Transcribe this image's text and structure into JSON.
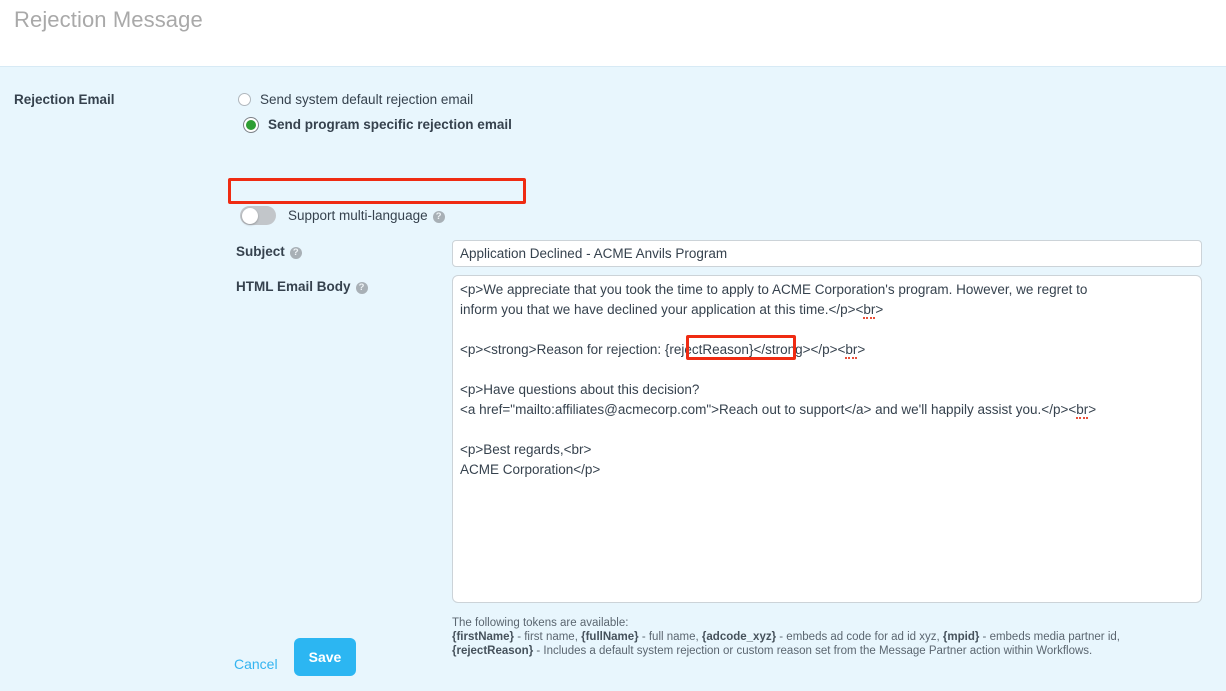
{
  "header": {
    "title": "Rejection Message"
  },
  "form": {
    "section_label": "Rejection Email",
    "radios": [
      {
        "label": "Send system default rejection email",
        "selected": false
      },
      {
        "label": "Send program specific rejection email",
        "selected": true
      }
    ],
    "toggle": {
      "label": "Support multi-language",
      "state": "off",
      "help_icon": "?"
    },
    "subject": {
      "label": "Subject",
      "help_icon": "?",
      "value": "Application Declined - ACME Anvils Program",
      "placeholder": ""
    },
    "html_email_body": {
      "label": "HTML Email Body",
      "help_icon": "?",
      "line1": "<p>We appreciate that you took the time to apply to ACME Corporation's program. However, we regret to",
      "line2": "inform you that we have declined your application at this time.</p><",
      "line2_tag": "br",
      "line2_end": ">",
      "line4_pre": "<p><strong>Reason for rejection: ",
      "line4_token": "{rejectReason}",
      "line4_post": "</strong></p><",
      "line4_tag": "br",
      "line4_end": ">",
      "line6": "<p>Have questions about this decision?",
      "line7": "<a href=\"mailto:affiliates@acmecorp.com\">Reach out to support</a> and we'll happily assist you.</p><",
      "line7_tag": "br",
      "line7_end": ">",
      "line9": "<p>Best regards,<br>",
      "line10": "ACME Corporation</p>"
    },
    "tokens_help": {
      "intro": "The following tokens are available:",
      "t1": "{firstName}",
      "t1_desc": " - first name, ",
      "t2": "{fullName}",
      "t2_desc": " - full name, ",
      "t3": "{adcode_xyz}",
      "t3_desc": " - embeds ad code for ad id xyz, ",
      "t4": "{mpid}",
      "t4_desc": " - embeds media partner id,",
      "t5": "{rejectReason}",
      "t5_desc": " - Includes a default system rejection or custom reason set from the Message Partner action within Workflows."
    },
    "buttons": {
      "cancel": "Cancel",
      "save": "Save"
    }
  },
  "colors": {
    "panel_bg": "#e8f6fd",
    "accent": "#2cb6f2",
    "link": "#34b4f0",
    "annotation": "#ef2b12",
    "radio_selected": "#2e9e33",
    "text": "#36424e",
    "title": "#a9a9a9"
  }
}
